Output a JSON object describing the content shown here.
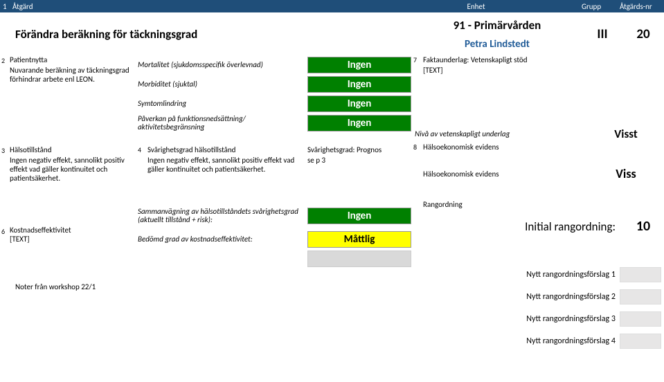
{
  "header": {
    "num": "1",
    "atgard": "Åtgärd",
    "enhet": "Enhet",
    "grupp": "Grupp",
    "atgardsnr": "Åtgärds-nr"
  },
  "title": "Förändra beräkning för täckningsgrad",
  "unit": "91 - Primärvården",
  "person": "Petra Lindstedt",
  "group": "III",
  "actionnr": "20",
  "sec2": {
    "num": "2",
    "heading": "Patientnytta",
    "body": "Nuvarande beräkning av täckningsgrad förhindrar arbete enl LEON.",
    "metrics": [
      {
        "label": "Mortalitet (sjukdomsspecifik överlevnad)",
        "value": "Ingen"
      },
      {
        "label": "Morbiditet (sjuktal)",
        "value": "Ingen"
      },
      {
        "label": "Symtomlindring",
        "value": "Ingen"
      },
      {
        "label": "Påverkan på funktionsnedsättning/ aktivitetsbegränsning",
        "value": "Ingen"
      }
    ]
  },
  "sec7": {
    "num": "7",
    "heading": "Faktaunderlag: Vetenskapligt stöd",
    "body": "[TEXT]",
    "niva_label": "Nivå av vetenskapligt underlag",
    "niva_value": "Visst"
  },
  "sec3": {
    "num": "3",
    "heading": "Hälsotillstånd",
    "body": "Ingen negativ effekt, sannolikt positiv effekt vad gäller kontinuitet och patientsäkerhet."
  },
  "sec4": {
    "num": "4",
    "heading": "Svårighetsgrad hälsotillstånd",
    "body": "Ingen negativ effekt, sannolikt positiv effekt vad gäller kontinuitet och patientsäkerhet."
  },
  "sec5": {
    "heading": "Svårighetsgrad: Prognos",
    "body": "se p 3"
  },
  "sec8": {
    "num": "8",
    "heading": "Hälsoekonomisk evidens",
    "ev_label": "Hälsoekonomisk evidens",
    "ev_value": "Viss"
  },
  "sec6": {
    "num": "6",
    "heading": "Kostnadseffektivitet",
    "body": "[TEXT]",
    "samman_label": "Sammanvägning av hälsotillståndets svårighetsgrad (aktuellt tillstånd + risk):",
    "samman_value": "Ingen",
    "bedomd_label": "Bedömd grad av kostnadseffektivitet:",
    "bedomd_value": "Måttlig"
  },
  "rangord": {
    "heading": "Rangordning",
    "initial_label": "Initial rangordning:",
    "initial_value": "10"
  },
  "notes": "Noter från workshop 22/1",
  "nytt": [
    "Nytt rangordningsförslag 1",
    "Nytt rangordningsförslag 2",
    "Nytt rangordningsförslag 3",
    "Nytt rangordningsförslag 4"
  ]
}
